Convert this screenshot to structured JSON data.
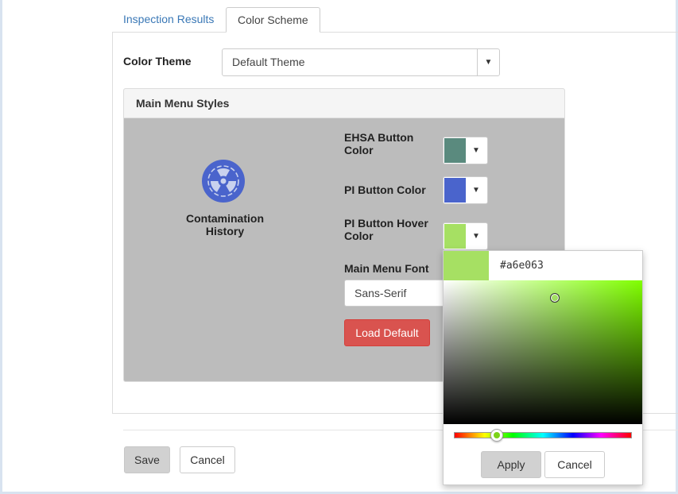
{
  "tabs": [
    {
      "label": "Inspection Results",
      "active": false
    },
    {
      "label": "Color Scheme",
      "active": true
    }
  ],
  "color_theme": {
    "label": "Color Theme",
    "selected": "Default Theme"
  },
  "main_menu_styles": {
    "title": "Main Menu Styles",
    "preview": {
      "icon": "radiation-icon",
      "label_line1": "Contamination",
      "label_line2": "History"
    },
    "ehsa_button": {
      "label_line1": "EHSA Button",
      "label_line2": "Color",
      "color": "#5a8a7e"
    },
    "pi_button": {
      "label": "PI Button Color",
      "color": "#4a64cc"
    },
    "pi_hover": {
      "label_line1": "PI Button Hover",
      "label_line2": "Color",
      "color": "#a6e063"
    },
    "font": {
      "label": "Main Menu Font",
      "selected": "Sans-Serif"
    },
    "load_default_label": "Load Default"
  },
  "footer": {
    "save_label": "Save",
    "cancel_label": "Cancel"
  },
  "color_picker": {
    "hex_value": "#a6e063",
    "hue_color": "#80ff00",
    "saturation": 0.56,
    "brightness": 0.88,
    "hue_fraction": 0.24,
    "apply_label": "Apply",
    "cancel_label": "Cancel"
  },
  "colors": {
    "link": "#3a78b6",
    "danger": "#d9534f",
    "panel_bg": "#bcbcbc"
  }
}
